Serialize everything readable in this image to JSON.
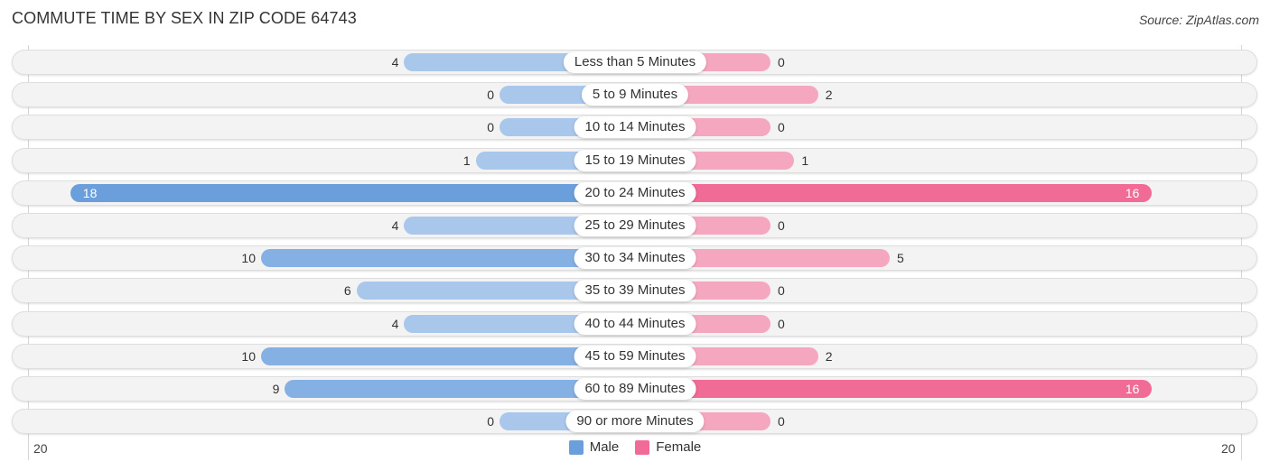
{
  "header": {
    "title": "COMMUTE TIME BY SEX IN ZIP CODE 64743",
    "source": "Source: ZipAtlas.com"
  },
  "colors": {
    "male": "#6a9fdc",
    "male_light": "#a8c7eb",
    "female": "#f06b96",
    "female_light": "#f6a7c0"
  },
  "chart_data": {
    "type": "bar",
    "orientation": "horizontal-diverging",
    "title": "COMMUTE TIME BY SEX IN ZIP CODE 64743",
    "categories": [
      "Less than 5 Minutes",
      "5 to 9 Minutes",
      "10 to 14 Minutes",
      "15 to 19 Minutes",
      "20 to 24 Minutes",
      "25 to 29 Minutes",
      "30 to 34 Minutes",
      "35 to 39 Minutes",
      "40 to 44 Minutes",
      "45 to 59 Minutes",
      "60 to 89 Minutes",
      "90 or more Minutes"
    ],
    "series": [
      {
        "name": "Male",
        "values": [
          4,
          0,
          0,
          1,
          18,
          4,
          10,
          6,
          4,
          10,
          9,
          0
        ]
      },
      {
        "name": "Female",
        "values": [
          0,
          2,
          0,
          1,
          16,
          0,
          5,
          0,
          0,
          2,
          16,
          0
        ]
      }
    ],
    "axis": {
      "left_tick": "20",
      "right_tick": "20",
      "range": [
        -20,
        20
      ]
    },
    "legend": {
      "position": "bottom-center",
      "entries": [
        "Male",
        "Female"
      ]
    }
  }
}
